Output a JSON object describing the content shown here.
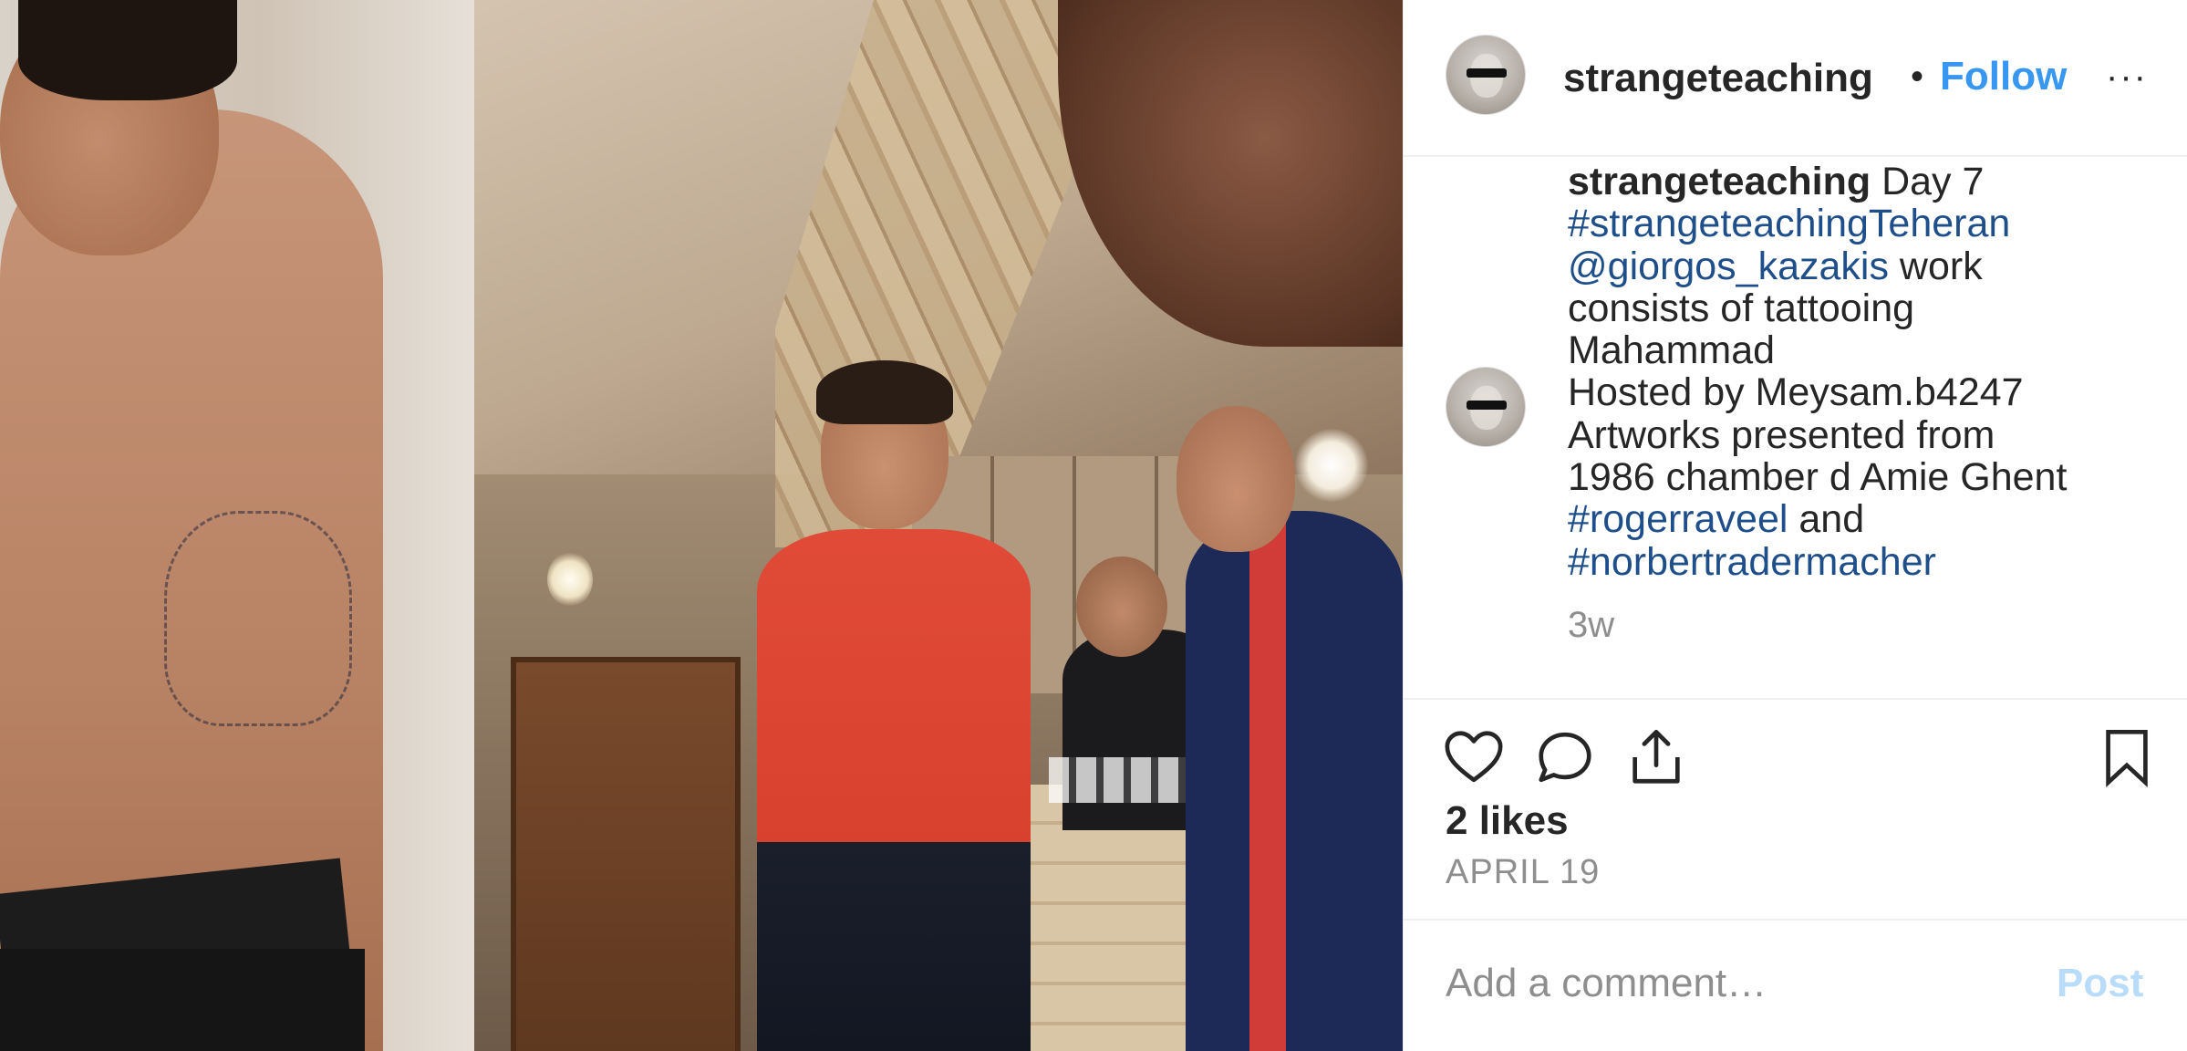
{
  "post": {
    "username": "strangeteaching",
    "dot": "•",
    "follow_label": "Follow",
    "more_label": "···"
  },
  "caption": {
    "username": "strangeteaching",
    "lines": [
      {
        "before": " Day 7",
        "tag": ""
      },
      {
        "before": "",
        "tag": "#strangeteachingTeheran"
      },
      {
        "tag": "@giorgos_kazakis",
        "after": " work"
      },
      {
        "text": "consists of tattooing"
      },
      {
        "text": "Mahammad"
      },
      {
        "text": "Hosted by Meysam.b4247"
      },
      {
        "text": "Artworks presented from"
      },
      {
        "text": "1986 chamber d Amie Ghent"
      },
      {
        "tag": "#rogerraveel",
        "after": " and"
      },
      {
        "tag": "#norbertradermacher"
      }
    ],
    "time_ago": "3w"
  },
  "actions": {
    "like_icon": "heart-icon",
    "comment_icon": "comment-icon",
    "share_icon": "share-icon",
    "save_icon": "bookmark-icon",
    "likes_text": "2 likes",
    "date_text": "APRIL 19"
  },
  "comment": {
    "placeholder": "Add a comment…",
    "post_label": "Post"
  },
  "colors": {
    "accent": "#3897f0",
    "hashtag": "#1f4f8a",
    "muted": "#8e8e8e",
    "post_disabled": "#b9dcfa"
  }
}
